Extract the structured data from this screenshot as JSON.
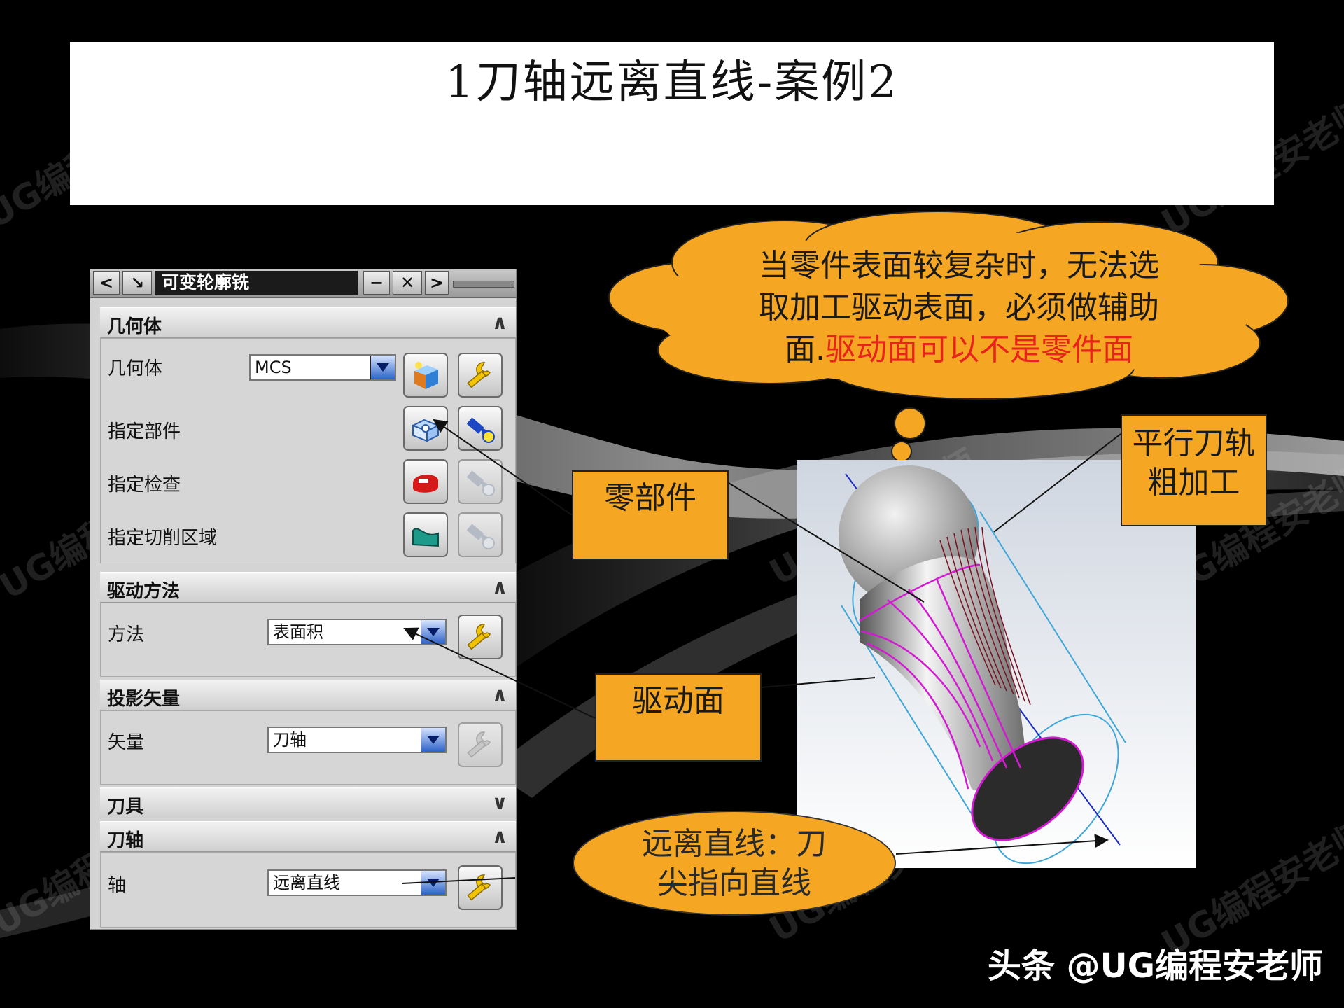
{
  "slide": {
    "title": "1刀轴远离直线-案例2",
    "watermark": "UG编程安老师",
    "footer": "头条 @UG编程安老师"
  },
  "dialog": {
    "title": "可变轮廓铣",
    "titlebar_buttons": [
      "<",
      "↘",
      "−",
      "✕",
      ">"
    ],
    "sections": {
      "geometry": {
        "header": "几何体",
        "geometry_label": "几何体",
        "geometry_value": "MCS",
        "specify_part": "指定部件",
        "specify_check": "指定检查",
        "specify_cut_area": "指定切削区域"
      },
      "drive_method": {
        "header": "驱动方法",
        "method_label": "方法",
        "method_value": "表面积"
      },
      "projection_vector": {
        "header": "投影矢量",
        "vector_label": "矢量",
        "vector_value": "刀轴"
      },
      "tool": {
        "header": "刀具"
      },
      "tool_axis": {
        "header": "刀轴",
        "axis_label": "轴",
        "axis_value": "远离直线"
      }
    }
  },
  "bubble": {
    "text_black": "当零件表面较复杂时，无法选取加工驱动表面，必须做辅助面.",
    "text_red": "驱动面可以不是零件面",
    "line1": "当零件表面较复杂时，无法选",
    "line2": "取加工驱动表面，必须做辅助",
    "line3_black": "面.",
    "line3_red": "驱动面可以不是零件面"
  },
  "callouts": {
    "part": "零部件",
    "drive_surface": "驱动面",
    "rough_line1": "平行刀轨",
    "rough_line2": "粗加工",
    "away_line1": "远离直线：刀",
    "away_line2": "尖指向直线"
  },
  "colors": {
    "callout_fill": "#f5a623",
    "bubble_fill": "#f5a623",
    "accent_red": "#e8231b",
    "toolpath_magenta": "#d21ad2",
    "cylinder_blue": "#3fa6d8",
    "viewport_bg_top": "#cfd6e0",
    "viewport_bg_bottom": "#ffffff"
  },
  "icons": [
    "geometry-cube-icon",
    "wrench-icon",
    "part-icon",
    "flashlight-icon",
    "check-body-icon",
    "cut-area-icon"
  ]
}
